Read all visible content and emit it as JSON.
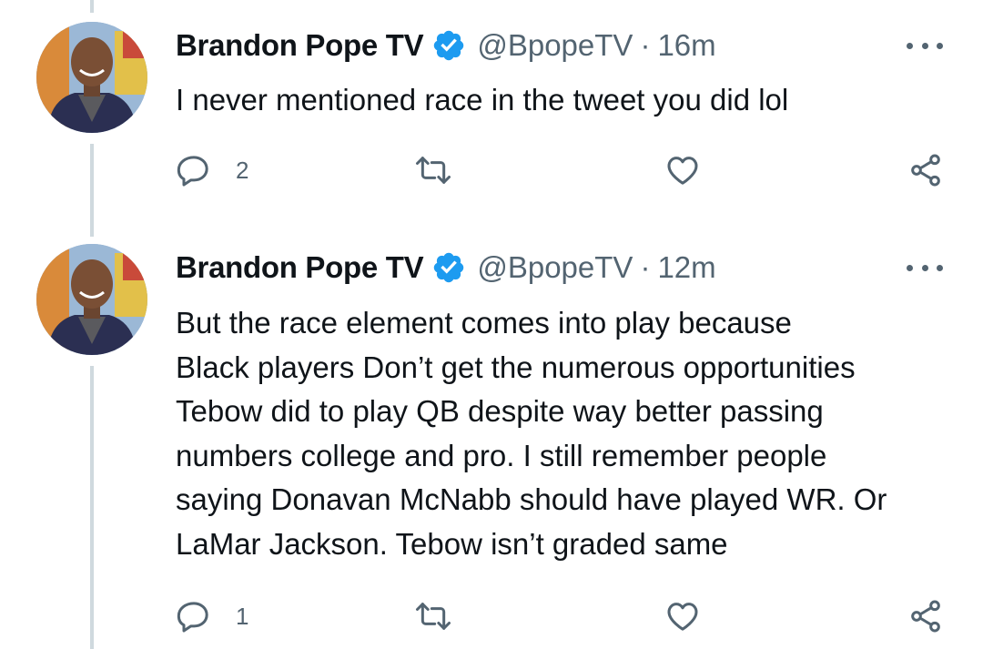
{
  "tweets": [
    {
      "author_name": "Brandon Pope TV",
      "handle": "@BpopeTV",
      "separator": "·",
      "time": "16m",
      "text": "I never mentioned race in the tweet you did lol",
      "reply_count": "2",
      "icons": [
        "reply-icon",
        "retweet-icon",
        "like-icon",
        "share-icon",
        "more-icon",
        "verified-icon"
      ]
    },
    {
      "author_name": "Brandon Pope TV",
      "handle": "@BpopeTV",
      "separator": "·",
      "time": "12m",
      "text_lines": [
        "But the race element comes into play because",
        "Black players Don’t get the numerous opportunities",
        "Tebow did to play QB despite way better passing",
        "numbers college and pro. I still remember people",
        "saying Donavan McNabb should have played WR. Or",
        "LaMar Jackson. Tebow isn’t graded same"
      ],
      "reply_count": "1"
    }
  ],
  "colors": {
    "text": "#0f1419",
    "secondary": "#536471",
    "verified": "#1d9bf0",
    "thread_line": "#cfd9de"
  }
}
